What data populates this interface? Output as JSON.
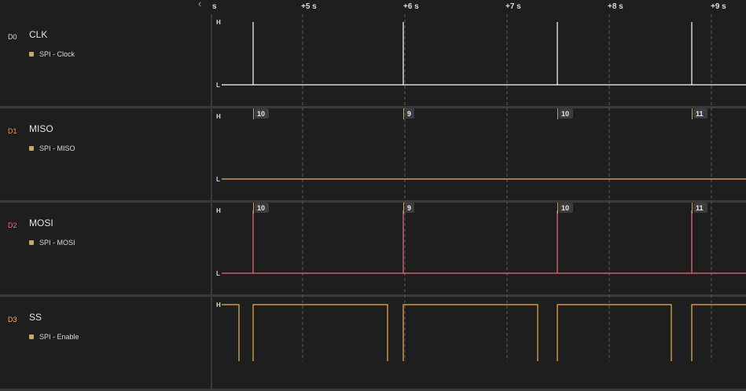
{
  "timeline": {
    "scroll_left_icon": "‹",
    "origin_label": "s",
    "ticks": [
      "+5 s",
      "+6 s",
      "+7 s",
      "+8 s",
      "+9 s"
    ]
  },
  "levels": {
    "high": "H",
    "low": "L"
  },
  "channels": [
    {
      "id": "D0",
      "name": "CLK",
      "color": "#ffffff",
      "id_color": "#d8d8d8",
      "analyzer": "SPI - Clock",
      "analyzer_color": "#c8a860",
      "pulses": [
        0.18,
        0.9,
        1.62,
        2.25
      ],
      "decodes": []
    },
    {
      "id": "D1",
      "name": "MISO",
      "color": "#f0b070",
      "id_color": "#e8945a",
      "analyzer": "SPI - MISO",
      "analyzer_color": "#c8a860",
      "pulses": [],
      "decodes": [
        "10",
        "9",
        "10",
        "11"
      ]
    },
    {
      "id": "D2",
      "name": "MOSI",
      "color": "#f06a7a",
      "id_color": "#f06a6a",
      "analyzer": "SPI - MOSI",
      "analyzer_color": "#c8a860",
      "pulses": [
        0.18,
        0.9,
        1.62,
        2.25
      ],
      "decodes": [
        "10",
        "9",
        "10",
        "11"
      ]
    },
    {
      "id": "D3",
      "name": "SS",
      "color": "#f0b050",
      "id_color": "#f0b050",
      "analyzer": "SPI - Enable",
      "analyzer_color": "#c8a860",
      "low_intervals": [
        [
          0.12,
          0.18
        ],
        [
          0.82,
          0.9
        ],
        [
          1.52,
          1.62
        ],
        [
          2.15,
          2.25
        ]
      ],
      "decodes": []
    }
  ],
  "colors": {
    "background": "#1e1e1e",
    "divider": "#3a3a3a",
    "grid": "#5a5a5a",
    "decode_bg": "#3c3c3c"
  }
}
